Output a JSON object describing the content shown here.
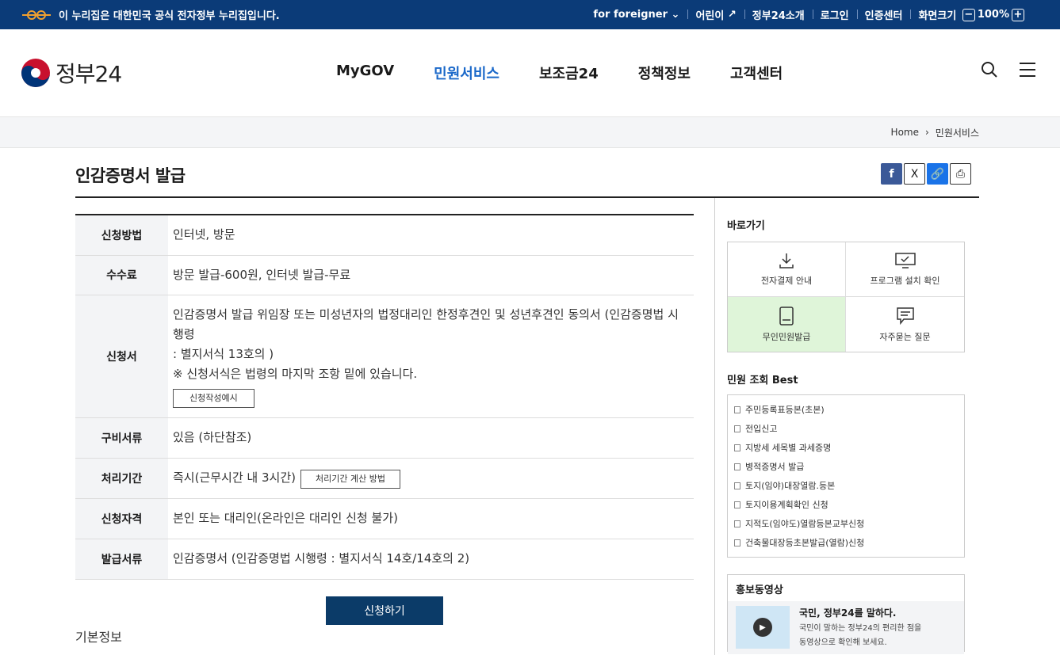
{
  "topbar": {
    "notice": "이 누리집은 대한민국 공식 전자정부 누리집입니다.",
    "foreigner": "for foreigner",
    "kids": "어린이",
    "about": "정부24소개",
    "login": "로그인",
    "cert": "인증센터",
    "screen_size": "화면크기",
    "zoom_level": "100%",
    "zoom_out": "−",
    "zoom_in": "+"
  },
  "header": {
    "logo_text": "정부24",
    "nav": [
      "MyGOV",
      "민원서비스",
      "보조금24",
      "정책정보",
      "고객센터"
    ]
  },
  "breadcrumb": {
    "home": "Home",
    "current": "민원서비스"
  },
  "page": {
    "title": "인감증명서 발급",
    "share": {
      "facebook": "f",
      "x": "X",
      "link": "🔗",
      "print": "⎙"
    }
  },
  "info": {
    "method_label": "신청방법",
    "method": "인터넷, 방문",
    "fee_label": "수수료",
    "fee": "방문 발급-600원, 인터넷 발급-무료",
    "form_label": "신청서",
    "form_line1": "인감증명서 발급 위임장 또는 미성년자의 법정대리인 한정후견인 및 성년후견인 동의서 (인감증명법 시행령",
    "form_line2": ": 별지서식 13호의 )",
    "form_line3": "※ 신청서식은 법령의 마지막 조항 밑에 있습니다.",
    "form_example_btn": "신청작성예시",
    "docs_label": "구비서류",
    "docs": "있음 (하단참조)",
    "period_label": "처리기간",
    "period": "즉시(근무시간 내 3시간)",
    "period_btn": "처리기간 계산 방법",
    "qual_label": "신청자격",
    "qual": "본인 또는 대리인(온라인은 대리인 신청 불가)",
    "issue_label": "발급서류",
    "issue": "인감증명서 (인감증명법 시행령 : 별지서식 14호/14호의 2)"
  },
  "apply_button": "신청하기",
  "basic_info": "기본정보",
  "sidebar": {
    "quick_title": "바로가기",
    "quick": [
      "전자결제 안내",
      "프로그램 설치 확인",
      "무인민원발급",
      "자주묻는 질문"
    ],
    "best_title": "민원 조회 Best",
    "best": [
      "주민등록표등본(초본)",
      "전입신고",
      "지방세 세목별 과세증명",
      "병적증명서 발급",
      "토지(임야)대장열람.등본",
      "토지이용계획확인 신청",
      "지적도(임야도)열람등본교부신청",
      "건축물대장등초본발급(열람)신청"
    ],
    "promo_title": "홍보동영상",
    "promo_headline": "국민, 정부24를 말하다.",
    "promo_line1": "국민이 말하는 정부24의 편리한 점을",
    "promo_line2": "동영상으로 확인해 보세요."
  },
  "colors": {
    "topbar": "#0b3b78",
    "nav_active": "#1a68c9",
    "apply": "#0b3b68",
    "quick_highlight": "#dff5d9"
  }
}
